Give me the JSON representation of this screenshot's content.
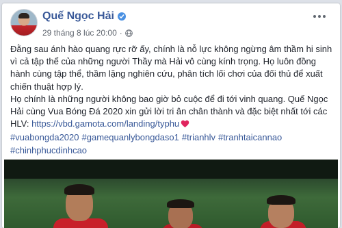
{
  "post": {
    "author": "Quế Ngọc Hải",
    "timestamp": "29 tháng 8 lúc 20:00",
    "paragraph1": "Đằng sau ánh hào quang rực rỡ ấy, chính là nỗ lực không ngừng âm thầm hi sinh vì cả tập thể của những người Thầy mà Hải vô cùng kính trọng. Họ luôn đồng hành cùng tập thể, thầm lặng nghiên cứu, phân tích lối chơi của đối thủ để xuất chiến thuật hợp lý.",
    "paragraph2": "Họ chính là những người không bao giờ bỏ cuộc để đi tới vinh quang. Quế Ngọc Hải cùng Vua Bóng Đá 2020 xin gửi lời tri ân chân thành và đặc biệt nhất tới các HLV: ",
    "link": "https://vbd.gamota.com/landing/typhu",
    "hashtags": [
      "#vuabongda2020",
      "#gamequanlybongdaso1",
      "#trianhlv",
      "#tranhtaicannao",
      "#chinhphucdinhcao"
    ]
  },
  "icons": {
    "verified": "verified-badge-icon",
    "globe": "globe-icon",
    "heart": "heart-icon",
    "more": "more-options-icon"
  },
  "colors": {
    "link": "#385898",
    "text": "#1d2129",
    "meta": "#616770",
    "heart": "#e0245e"
  }
}
